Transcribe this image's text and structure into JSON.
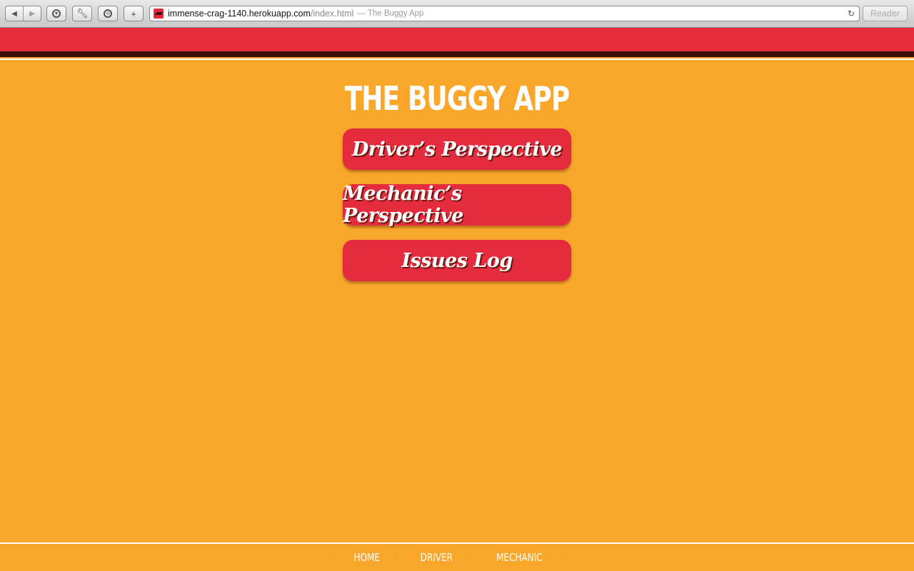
{
  "browser": {
    "url_host": "immense-crag-1140.herokuapp.com",
    "url_path": "/index.html",
    "page_title": "— The Buggy App",
    "reader_label": "Reader",
    "icons": {
      "back": "back-arrow-icon",
      "forward": "forward-arrow-icon",
      "downloads": "downloads-icon",
      "tools": "wrench-icon",
      "sync": "sync-icon",
      "new_tab": "plus-icon",
      "reload": "reload-icon",
      "favicon": "site-favicon-icon"
    }
  },
  "colors": {
    "page_background": "#f9a72b",
    "header_red": "#e42c3e",
    "header_dark": "#3c0d08",
    "button_red": "#e42c3e",
    "text_white": "#ffffff"
  },
  "main": {
    "title": "THE BUGGY APP",
    "buttons": [
      {
        "label": "Driver’s Perspective"
      },
      {
        "label": "Mechanic’s Perspective"
      },
      {
        "label": "Issues Log"
      }
    ]
  },
  "footer": {
    "separator": "·",
    "links": [
      {
        "label": "HOME"
      },
      {
        "label": "DRIVER"
      },
      {
        "label": "MECHANIC"
      }
    ]
  }
}
